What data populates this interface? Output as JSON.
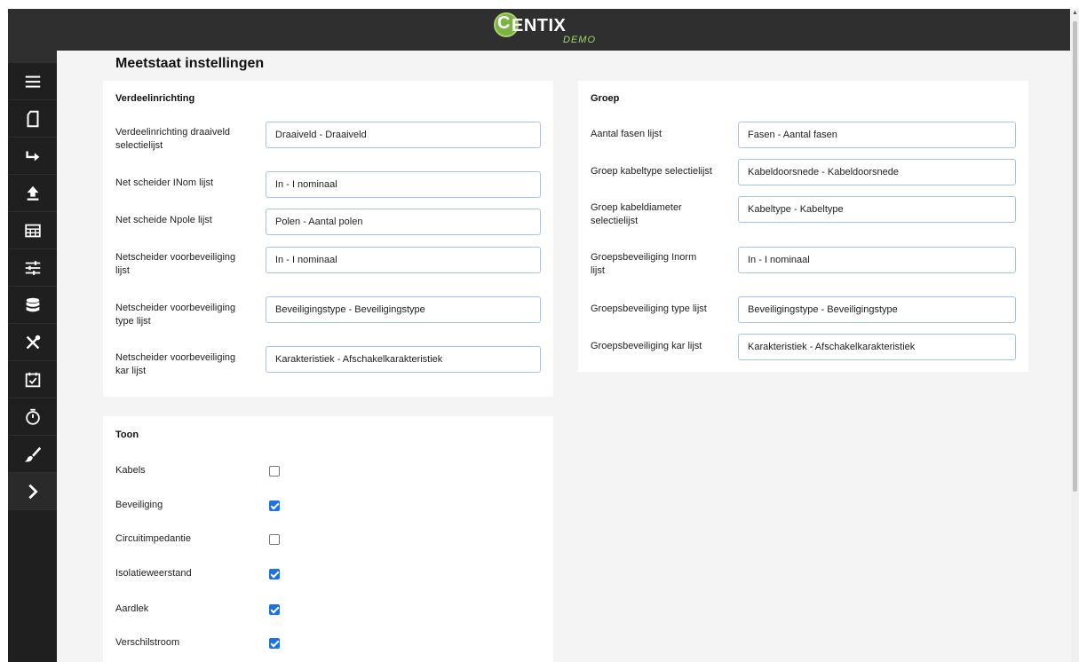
{
  "app": {
    "logo_text": "ENTIX",
    "logo_initial": "C",
    "logo_sub": "DEMO"
  },
  "page": {
    "title": "Meetstaat instellingen"
  },
  "sidebar": {
    "items": [
      {
        "icon": "menu-icon"
      },
      {
        "icon": "document-icon"
      },
      {
        "icon": "redirect-arrow-icon"
      },
      {
        "icon": "upload-icon"
      },
      {
        "icon": "table-icon"
      },
      {
        "icon": "sliders-icon"
      },
      {
        "icon": "database-icon"
      },
      {
        "icon": "tools-icon"
      },
      {
        "icon": "calendar-check-icon"
      },
      {
        "icon": "timer-icon"
      },
      {
        "icon": "brush-icon"
      },
      {
        "icon": "chevron-right-icon"
      }
    ]
  },
  "verdeel": {
    "title": "Verdeelinrichting",
    "fields": [
      {
        "label": "Verdeelinrichting draaiveld selectielijst",
        "value": "Draaiveld - Draaiveld"
      },
      {
        "label": "Net scheider INom lijst",
        "value": "In - I nominaal"
      },
      {
        "label": "Net scheide Npole lijst",
        "value": "Polen - Aantal polen"
      },
      {
        "label": "Netscheider voorbeveiliging lijst",
        "value": "In - I nominaal"
      },
      {
        "label": "Netscheider voorbeveiliging type lijst",
        "value": "Beveiligingstype - Beveiligingstype"
      },
      {
        "label": "Netscheider voorbeveiliging kar lijst",
        "value": "Karakteristiek - Afschakelkarakteristiek"
      }
    ]
  },
  "groep": {
    "title": "Groep",
    "fields": [
      {
        "label": "Aantal fasen lijst",
        "value": "Fasen - Aantal fasen"
      },
      {
        "label": "Groep kabeltype selectielijst",
        "value": "Kabeldoorsnede - Kabeldoorsnede"
      },
      {
        "label": "Groep kabeldiameter selectielijst",
        "value": "Kabeltype - Kabeltype"
      },
      {
        "label": "Groepsbeveiliging Inorm lijst",
        "value": "In - I nominaal"
      },
      {
        "label": "Groepsbeveiliging type lijst",
        "value": "Beveiligingstype - Beveiligingstype"
      },
      {
        "label": "Groepsbeveiliging kar lijst",
        "value": "Karakteristiek - Afschakelkarakteristiek"
      }
    ]
  },
  "toon": {
    "title": "Toon",
    "items": [
      {
        "label": "Kabels",
        "checked": false
      },
      {
        "label": "Beveiliging",
        "checked": true
      },
      {
        "label": "Circuitimpedantie",
        "checked": false
      },
      {
        "label": "Isolatieweerstand",
        "checked": true
      },
      {
        "label": "Aardlek",
        "checked": true
      },
      {
        "label": "Verschilstroom",
        "checked": true
      }
    ]
  },
  "colors": {
    "header": "#2f2f2f",
    "sidebar": "#1f1f1f",
    "accent": "#1a73e8",
    "brand": "#7cb342"
  }
}
